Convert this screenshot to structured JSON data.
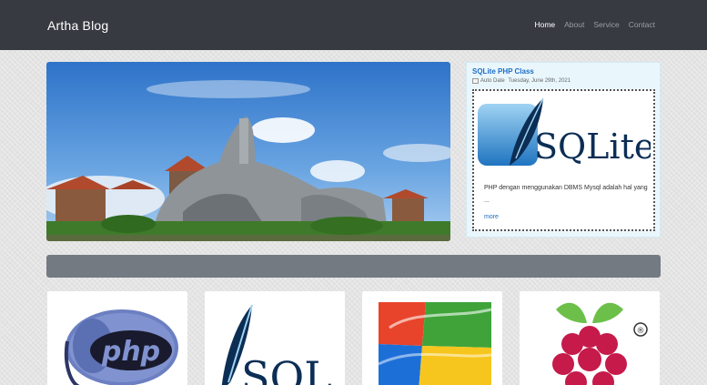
{
  "brand": {
    "name": "Artha Blog"
  },
  "nav": {
    "items": [
      "Home",
      "About",
      "Service",
      "Contact"
    ]
  },
  "hero": {
    "image": "bali-statue-photo"
  },
  "post": {
    "title": "SQLite PHP Class",
    "image_alt": "Auto Date",
    "date": "Tuesday, June 29th, 2021",
    "logo_text": "SQLite",
    "excerpt": "PHP dengan menggunakan DBMS Mysql adalah hal yang ...",
    "more_label": "more"
  },
  "thumbnails": [
    {
      "name": "php-elephant-logo",
      "text": "php"
    },
    {
      "name": "sql-logo",
      "text": "SQL"
    },
    {
      "name": "windows-logo",
      "text": ""
    },
    {
      "name": "raspberry-pi-logo",
      "text": "®"
    }
  ],
  "colors": {
    "navbar": "#373a41",
    "link": "#1f6dc4",
    "card_bg": "#e9f7fd",
    "banner": "#747a82"
  }
}
